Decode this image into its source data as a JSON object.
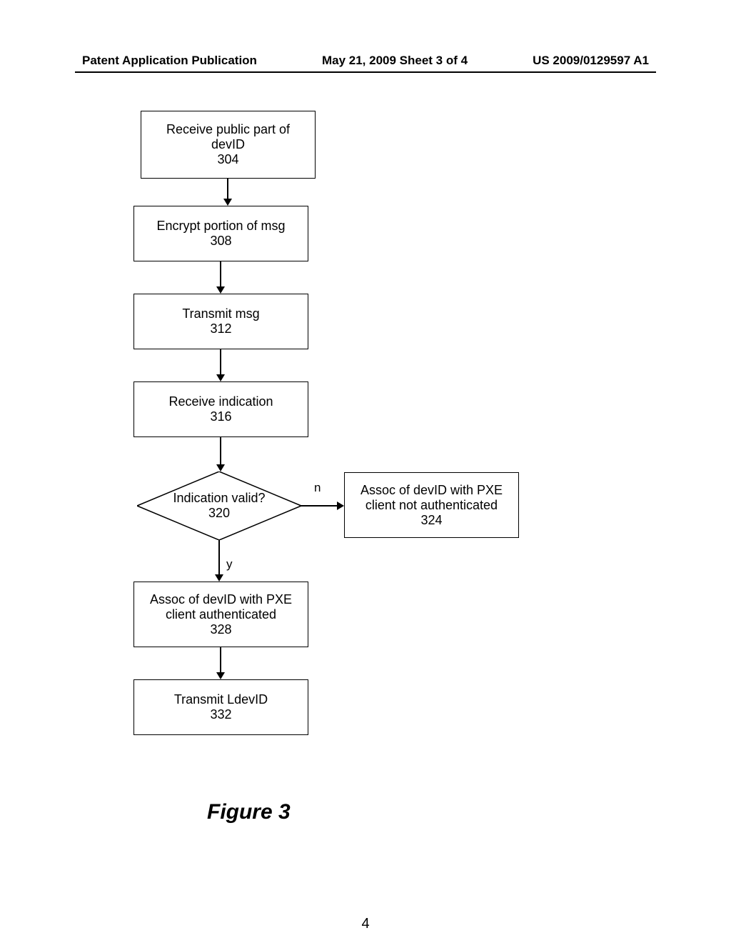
{
  "header": {
    "left": "Patent Application Publication",
    "center": "May 21, 2009  Sheet 3 of 4",
    "right": "US 2009/0129597 A1"
  },
  "boxes": {
    "b304": {
      "line1": "Receive public part of",
      "line2": "devID",
      "num": "304"
    },
    "b308": {
      "line1": "Encrypt portion of msg",
      "num": "308"
    },
    "b312": {
      "line1": "Transmit msg",
      "num": "312"
    },
    "b316": {
      "line1": "Receive indication",
      "num": "316"
    },
    "d320": {
      "line1": "Indication valid?",
      "num": "320"
    },
    "b324": {
      "line1": "Assoc of devID with PXE",
      "line2": "client not authenticated",
      "num": "324"
    },
    "b328": {
      "line1": "Assoc of devID with PXE",
      "line2": "client authenticated",
      "num": "328"
    },
    "b332": {
      "line1": "Transmit LdevID",
      "num": "332"
    }
  },
  "labels": {
    "no": "n",
    "yes": "y"
  },
  "figure": "Figure 3",
  "page": "4"
}
